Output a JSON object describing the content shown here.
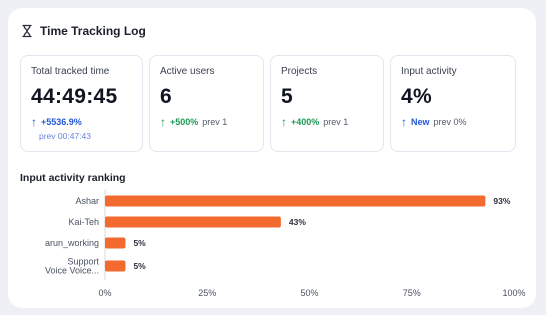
{
  "header": {
    "title": "Time Tracking Log",
    "icon": "hourglass-icon"
  },
  "stats": [
    {
      "label": "Total tracked time",
      "value": "44:49:45",
      "change": "+5536.9%",
      "direction": "up",
      "color": "#2357d8",
      "prev": "prev 00:47:43"
    },
    {
      "label": "Active users",
      "value": "6",
      "change": "+500%",
      "direction": "up",
      "color": "#1a9a55",
      "prev": "prev 1"
    },
    {
      "label": "Projects",
      "value": "5",
      "change": "+400%",
      "direction": "up",
      "color": "#1a9a55",
      "prev": "prev 1"
    },
    {
      "label": "Input activity",
      "value": "4%",
      "change": "New",
      "direction": "up",
      "color": "#2357d8",
      "prev": "prev 0%"
    }
  ],
  "ranking": {
    "title": "Input activity ranking"
  },
  "chart_data": {
    "type": "bar",
    "orientation": "horizontal",
    "categories": [
      "Ashar",
      "Kai-Teh",
      "arun_working",
      "Support Voice Voice..."
    ],
    "category_lines": [
      [
        "Ashar"
      ],
      [
        "Kai-Teh"
      ],
      [
        "arun_working"
      ],
      [
        "Support",
        "Voice Voice..."
      ]
    ],
    "values": [
      93,
      43,
      5,
      5
    ],
    "value_labels": [
      "93%",
      "43%",
      "5%",
      "5%"
    ],
    "xlim": [
      0,
      100
    ],
    "xticks": [
      "0%",
      "25%",
      "50%",
      "75%",
      "100%"
    ],
    "bar_color": "#f26a2e",
    "grid": false
  }
}
